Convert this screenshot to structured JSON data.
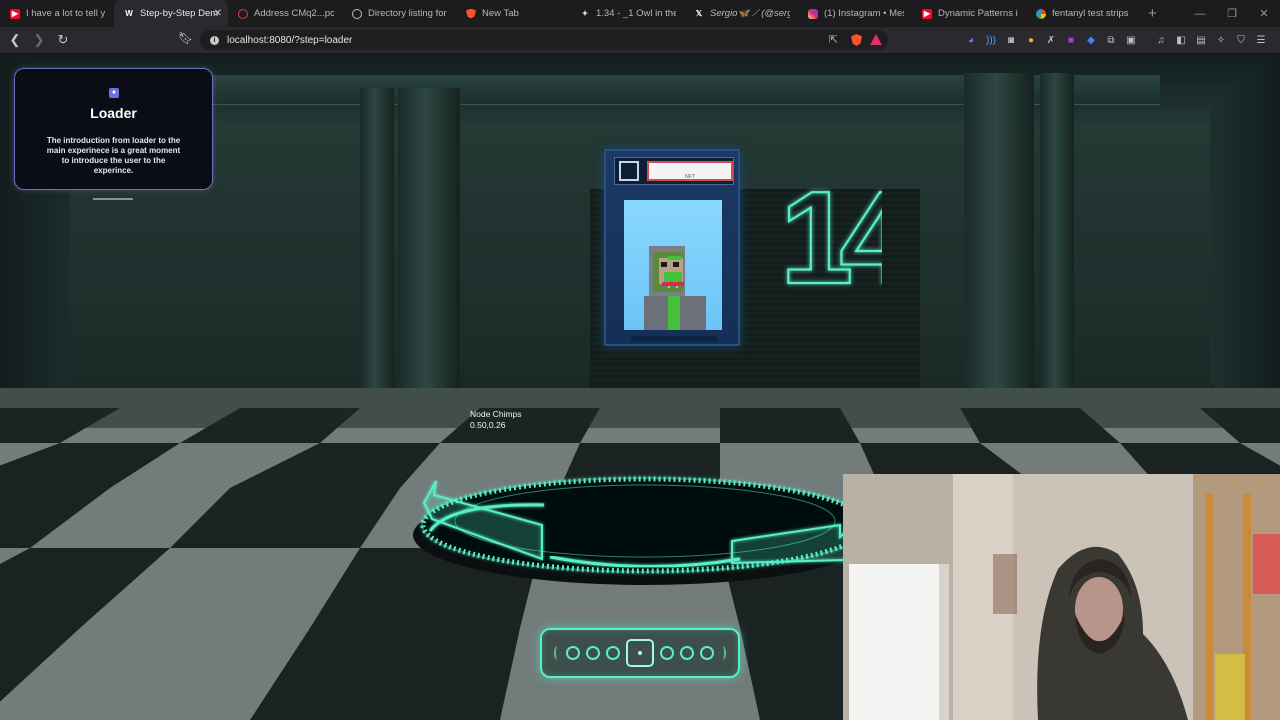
{
  "browser": {
    "tabs": [
      {
        "title": "I have a lot to tell y",
        "icon": "youtube-icon",
        "color": "#ff0033",
        "active": false
      },
      {
        "title": "Step-by-Step Dem",
        "icon": "w-logo-icon",
        "color": "#ffffff",
        "active": true
      },
      {
        "title": "Address CMq2...pcrF",
        "icon": "circle-icon",
        "color": "#e04040",
        "active": false
      },
      {
        "title": "Directory listing for /",
        "icon": "globe-icon",
        "color": "#bbbbbb",
        "active": false
      },
      {
        "title": "New Tab",
        "icon": "brave-icon",
        "color": "#fb542b",
        "active": false
      },
      {
        "title": "1.34 - _1 Owl in the N",
        "icon": "app-icon",
        "color": "#dddddd",
        "active": false
      },
      {
        "title": "Sergio🦋 ⟋ (@sergio",
        "icon": "x-icon",
        "color": "#ffffff",
        "active": false
      },
      {
        "title": "(1) Instagram • Messa",
        "icon": "instagram-icon",
        "color": "#d62976",
        "active": false
      },
      {
        "title": "Dynamic Patterns in W",
        "icon": "youtube-icon",
        "color": "#ff0033",
        "active": false
      },
      {
        "title": "fentanyl test strips - G",
        "icon": "google-icon",
        "color": "#4285f4",
        "active": false
      }
    ],
    "url": "localhost:8080/?step=loader",
    "accent": "#fb542b"
  },
  "card": {
    "title": "Loader",
    "body": "The introduction from loader to the main experinece is a great moment to introduce the user to the experince."
  },
  "scene": {
    "numeral": "14",
    "nft_label": "NFT",
    "node_label": "Node Chimps",
    "node_coords": "0.50,0.26",
    "accent": "#58f0c8"
  },
  "stepper": {
    "total": 7,
    "active_index": 3
  }
}
